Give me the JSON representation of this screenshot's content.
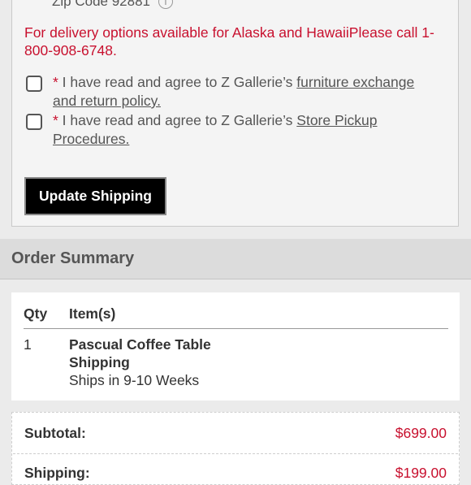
{
  "shipping": {
    "zip_label": "Zip Code 92881",
    "info_icon": "i",
    "delivery_note": "For delivery options available for Alaska and HawaiiPlease call 1-800-908-6748.",
    "agreements": [
      {
        "required_mark": "*",
        "text": " I have read and agree to Z Gallerie’s ",
        "link_text": "furniture exchange and return policy."
      },
      {
        "required_mark": "*",
        "text": " I have read and agree to Z Gallerie’s ",
        "link_text": "Store Pickup Procedures."
      }
    ],
    "update_button": "Update Shipping"
  },
  "order_summary": {
    "title": "Order Summary",
    "columns": {
      "qty": "Qty",
      "items": "Item(s)"
    },
    "rows": [
      {
        "qty": "1",
        "name": "Pascual Coffee Table",
        "shipping_label": "Shipping",
        "ship_time": "Ships in 9-10 Weeks"
      }
    ],
    "subtotal_label": "Subtotal:",
    "subtotal_value": "$699.00",
    "shipping_label": "Shipping:",
    "shipping_value": "$199.00"
  },
  "colors": {
    "accent_red": "#c8102e",
    "button_bg": "#000000",
    "panel_bg": "#f4f4f4"
  }
}
